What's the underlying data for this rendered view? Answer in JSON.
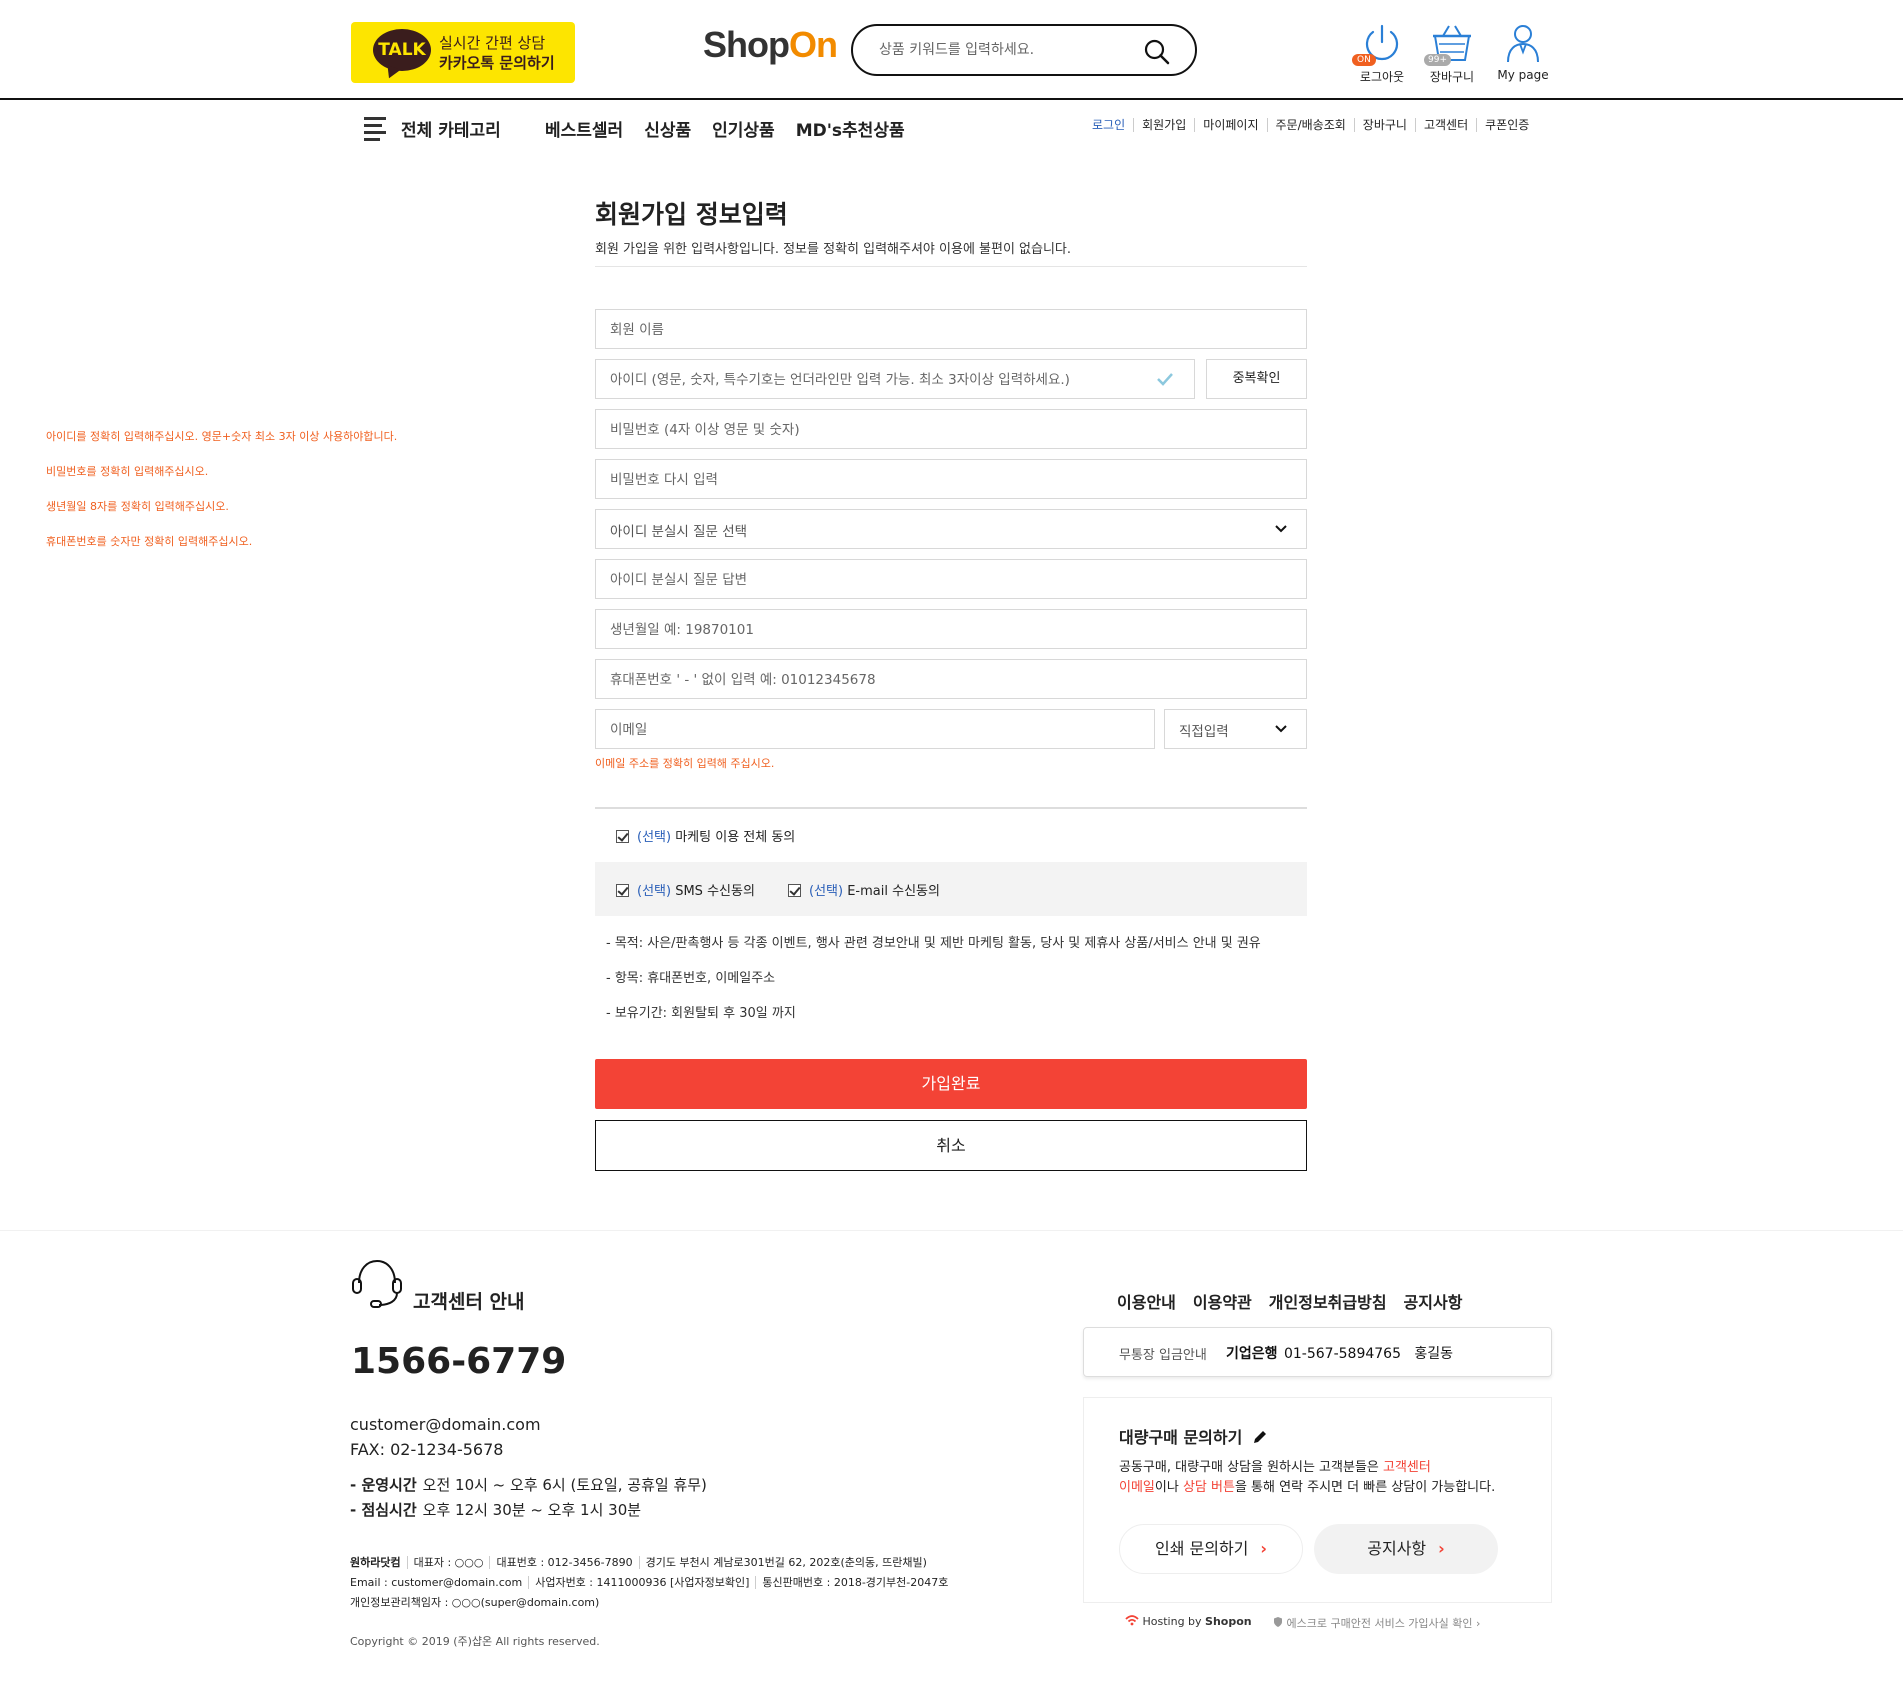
{
  "header": {
    "kakao": {
      "badge": "TALK",
      "line1": "실시간 간편 상담",
      "line2": "카카오톡 문의하기"
    },
    "logo": {
      "part1": "Shop",
      "part2": "On",
      "accent_color": "#f28b00"
    },
    "search": {
      "placeholder": "상품 키워드를 입력하세요.",
      "icon": "search-icon"
    },
    "icons": [
      {
        "name": "power-icon",
        "label": "로그아웃",
        "badge": "ON"
      },
      {
        "name": "basket-icon",
        "label": "장바구니",
        "badge": "99+"
      },
      {
        "name": "user-icon",
        "label": "My page"
      }
    ]
  },
  "nav": {
    "category_label": "전체 카테고리",
    "main_menu": [
      "베스트셀러",
      "신상품",
      "인기상품",
      "MD's추천상품"
    ],
    "util_menu": [
      "로그인",
      "회원가입",
      "마이페이지",
      "주문/배송조회",
      "장바구니",
      "고객센터",
      "쿠폰인증"
    ]
  },
  "errors": [
    "아이디를 정확히 입력해주십시오. 영문+숫자 최소 3자 이상 사용하야합니다.",
    "비밀번호를 정확히 입력해주십시오.",
    "생년월일 8자를 정확히 입력해주십시오.",
    "휴대폰번호를 숫자만 정확히 입력해주십시오."
  ],
  "form": {
    "title": "회원가입 정보입력",
    "description": "회원 가입을 위한 입력사항입니다. 정보를 정확히 입력해주셔야 이용에 불편이 없습니다.",
    "name_placeholder": "회원 이름",
    "id_placeholder": "아이디 (영문, 숫자, 특수기호는 언더라인만 입력 가능. 최소 3자이상 입력하세요.)",
    "dup_check_label": "중복확인",
    "password_placeholder": "비밀번호 (4자 이상 영문 및 숫자)",
    "password_confirm_placeholder": "비밀번호 다시 입력",
    "question_select": "아이디 분실시 질문 선택",
    "answer_placeholder": "아이디 분실시 질문 답변",
    "birth_placeholder": "생년월일 예: 19870101",
    "phone_placeholder": "휴대폰번호 ' - ' 없이 입력 예: 01012345678",
    "email_placeholder": "이메일",
    "email_domain_select": "직접입력",
    "email_error": "이메일 주소를 정확히 입력해 주십시오.",
    "agree": {
      "tag": "(선택)",
      "all_label": "마케팅 이용 전체 동의",
      "sms_label": "SMS 수신동의",
      "email_label": "E-mail 수신동의",
      "notes": [
        "- 목적: 사은/판촉행사 등 각종 이벤트, 행사 관련 경보안내 및 제반 마케팅 활동, 당사 및 제휴사 상품/서비스 안내 및 권유",
        "- 항목: 휴대폰번호, 이메일주소",
        "- 보유기간: 회원탈퇴 후 30일 까지"
      ]
    },
    "submit_label": "가입완료",
    "cancel_label": "취소",
    "submit_color": "#f34336",
    "error_color": "#f06020"
  },
  "footer": {
    "cs_title": "고객센터 안내",
    "phone": "1566-6779",
    "email": "customer@domain.com",
    "fax": "FAX: 02-1234-5678",
    "hours_label": "- 운영시간",
    "hours_value": "오전 10시 ~ 오후 6시 (토요일, 공휴일 휴무)",
    "lunch_label": "- 점심시간",
    "lunch_value": "오후 12시 30분 ~ 오후 1시 30분",
    "corp_line1": [
      "원하라닷컴",
      "대표자 : ○○○",
      "대표번호 : 012-3456-7890",
      "경기도 부천시 계남로301번길 62, 202호(춘의동, 뜨란채빌)"
    ],
    "corp_line2": [
      "Email : customer@domain.com",
      "사업자번호 : 1411000936 [사업자정보확인]",
      "통신판매번호 : 2018-경기부천-2047호"
    ],
    "corp_line3": "개인정보관리책임자 : ○○○(super@domain.com)",
    "copyright": "Copyright © 2019 (주)샵온 All rights reserved.",
    "links": [
      "이용안내",
      "이용약관",
      "개인정보취급방침",
      "공지사항"
    ],
    "bank": {
      "label": "무통장 입금안내",
      "bank_name": "기업은행",
      "account": "01-567-5894765",
      "holder": "홍길동"
    },
    "bulk": {
      "title": "대량구매 문의하기",
      "desc1_a": "공동구매, 대량구매 상담을 원하시는 고객분들은 ",
      "desc1_hl": "고객센터",
      "desc2_hl1": "이메일",
      "desc2_a": "이나 ",
      "desc2_hl2": "상담 버튼",
      "desc2_b": "을 통해 연락 주시면 더 빠른 상담이 가능합니다.",
      "btn1": "인쇄 문의하기",
      "btn2": "공지사항"
    },
    "hosting_a": "Hosting by ",
    "hosting_b": "Shopon",
    "escrow": "에스크로 구매안전 서비스 가입사실 확인"
  }
}
